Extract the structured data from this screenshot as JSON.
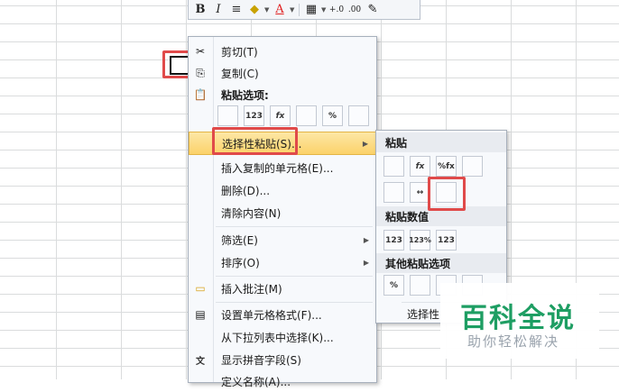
{
  "toolbar": {
    "bold": "B",
    "italic": "I",
    "align": "≡",
    "fill": "◆",
    "font_color": "A",
    "borders": "▦",
    "inc_decimal": "+.0",
    "dec_decimal": ".00",
    "format_painter": "✎",
    "colors": {
      "fill": "#f3d340",
      "font_color": "#e02020"
    }
  },
  "menu": {
    "cut": "剪切(T)",
    "copy": "复制(C)",
    "paste_options": "粘贴选项:",
    "paste_icons": [
      "",
      "123",
      "fx",
      "",
      "%",
      ""
    ],
    "paste_special": "选择性粘贴(S)...",
    "insert_copied": "插入复制的单元格(E)...",
    "delete": "删除(D)...",
    "clear": "清除内容(N)",
    "filter": "筛选(E)",
    "sort": "排序(O)",
    "insert_comment": "插入批注(M)",
    "format_cells": "设置单元格格式(F)...",
    "pick_from_list": "从下拉列表中选择(K)...",
    "show_phonetic": "显示拼音字段(S)",
    "define_name": "定义名称(A)..."
  },
  "submenu": {
    "paste_header": "粘贴",
    "paste_row1": [
      "",
      "fx",
      "%fx",
      ""
    ],
    "paste_row2": [
      "",
      "↔",
      ""
    ],
    "values_header": "粘贴数值",
    "values_row": [
      "123",
      "123%",
      "123"
    ],
    "other_header": "其他粘贴选项",
    "other_row": [
      "%",
      "",
      "",
      ""
    ],
    "footer": "选择性"
  },
  "watermark": {
    "title": "百科全说",
    "subtitle": "助你轻松解决",
    "color": "#1e9e63"
  },
  "highlight_color": "#e04a4a"
}
